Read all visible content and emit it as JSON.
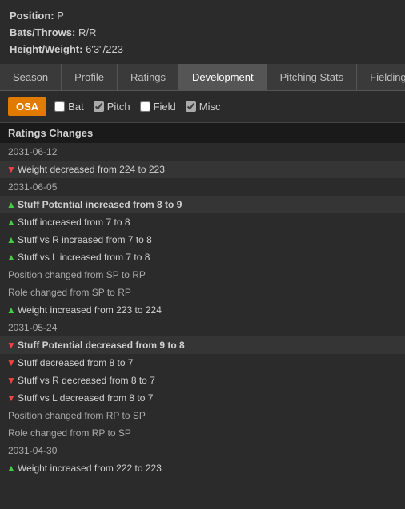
{
  "player": {
    "position_label": "Position:",
    "position_value": "P",
    "bats_throws_label": "Bats/Throws:",
    "bats_throws_value": "R/R",
    "height_weight_label": "Height/Weight:",
    "height_weight_value": "6'3\"/223"
  },
  "tabs": [
    {
      "id": "season",
      "label": "Season",
      "active": false
    },
    {
      "id": "profile",
      "label": "Profile",
      "active": false
    },
    {
      "id": "ratings",
      "label": "Ratings",
      "active": false
    },
    {
      "id": "development",
      "label": "Development",
      "active": true
    },
    {
      "id": "pitching-stats",
      "label": "Pitching Stats",
      "active": false
    },
    {
      "id": "fielding-s",
      "label": "Fielding S",
      "active": false
    }
  ],
  "filter": {
    "osa_label": "OSA",
    "checkboxes": [
      {
        "id": "bat",
        "label": "Bat",
        "checked": false
      },
      {
        "id": "pitch",
        "label": "Pitch",
        "checked": true
      },
      {
        "id": "field",
        "label": "Field",
        "checked": false
      },
      {
        "id": "misc",
        "label": "Misc",
        "checked": true
      }
    ]
  },
  "ratings_changes": {
    "header": "Ratings Changes",
    "entries": [
      {
        "type": "date",
        "text": "2031-06-12"
      },
      {
        "type": "down",
        "text": "Weight decreased from 224 to 223",
        "bold": false,
        "highlight": true
      },
      {
        "type": "date",
        "text": "2031-06-05"
      },
      {
        "type": "up",
        "text": "Stuff Potential increased from 8 to 9",
        "bold": true,
        "highlight": true
      },
      {
        "type": "up",
        "text": "Stuff increased from 7 to 8",
        "bold": false,
        "highlight": false
      },
      {
        "type": "up",
        "text": "Stuff vs R increased from 7 to 8",
        "bold": false,
        "highlight": false
      },
      {
        "type": "up",
        "text": "Stuff vs L increased from 7 to 8",
        "bold": false,
        "highlight": false
      },
      {
        "type": "neutral",
        "text": "Position changed from SP to RP"
      },
      {
        "type": "neutral",
        "text": "Role changed from SP to RP"
      },
      {
        "type": "up",
        "text": "Weight increased from 223 to 224",
        "bold": false,
        "highlight": false
      },
      {
        "type": "date",
        "text": "2031-05-24"
      },
      {
        "type": "down",
        "text": "Stuff Potential decreased from 9 to 8",
        "bold": true,
        "highlight": true
      },
      {
        "type": "down",
        "text": "Stuff decreased from 8 to 7",
        "bold": false,
        "highlight": false
      },
      {
        "type": "down",
        "text": "Stuff vs R decreased from 8 to 7",
        "bold": false,
        "highlight": false
      },
      {
        "type": "down",
        "text": "Stuff vs L decreased from 8 to 7",
        "bold": false,
        "highlight": false
      },
      {
        "type": "neutral",
        "text": "Position changed from RP to SP"
      },
      {
        "type": "neutral",
        "text": "Role changed from RP to SP"
      },
      {
        "type": "date",
        "text": "2031-04-30"
      },
      {
        "type": "up",
        "text": "Weight increased from 222 to 223",
        "bold": false,
        "highlight": false
      }
    ]
  }
}
